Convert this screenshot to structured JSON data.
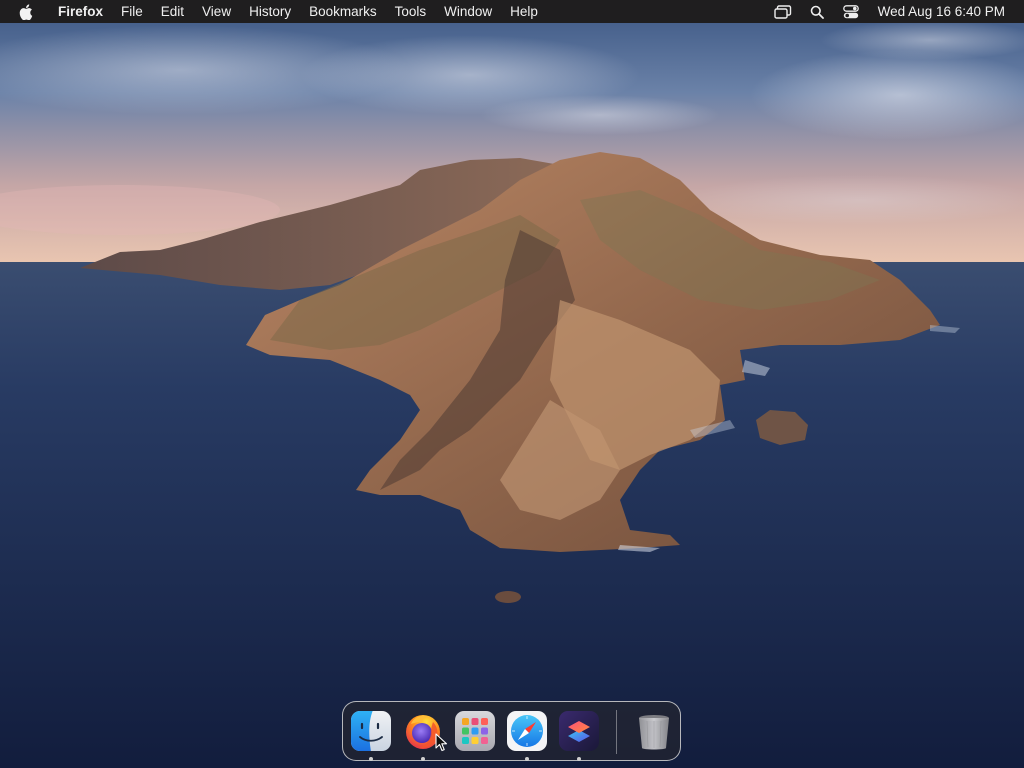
{
  "menubar": {
    "apple_icon": "apple-logo-icon",
    "app_name": "Firefox",
    "menus": [
      "File",
      "Edit",
      "View",
      "History",
      "Bookmarks",
      "Tools",
      "Window",
      "Help"
    ],
    "status_icons": [
      "screen-mirroring-icon",
      "spotlight-search-icon",
      "control-center-icon"
    ],
    "clock": "Wed Aug 16  6:40 PM"
  },
  "dock": {
    "apps": [
      {
        "name": "Finder",
        "icon": "finder-icon",
        "running": true
      },
      {
        "name": "Firefox",
        "icon": "firefox-icon",
        "running": true
      },
      {
        "name": "Launchpad",
        "icon": "launchpad-icon",
        "running": false
      },
      {
        "name": "Safari",
        "icon": "safari-icon",
        "running": true
      },
      {
        "name": "Shortcuts",
        "icon": "shortcuts-icon",
        "running": true
      }
    ],
    "trash": {
      "name": "Trash",
      "icon": "trash-icon"
    }
  },
  "wallpaper": {
    "name": "macOS Catalina island",
    "colors": {
      "sky_top": "#3d5a86",
      "horizon": "#e9c2ae",
      "sea": "#1b2a4c",
      "rock": "#a77a5a"
    }
  }
}
